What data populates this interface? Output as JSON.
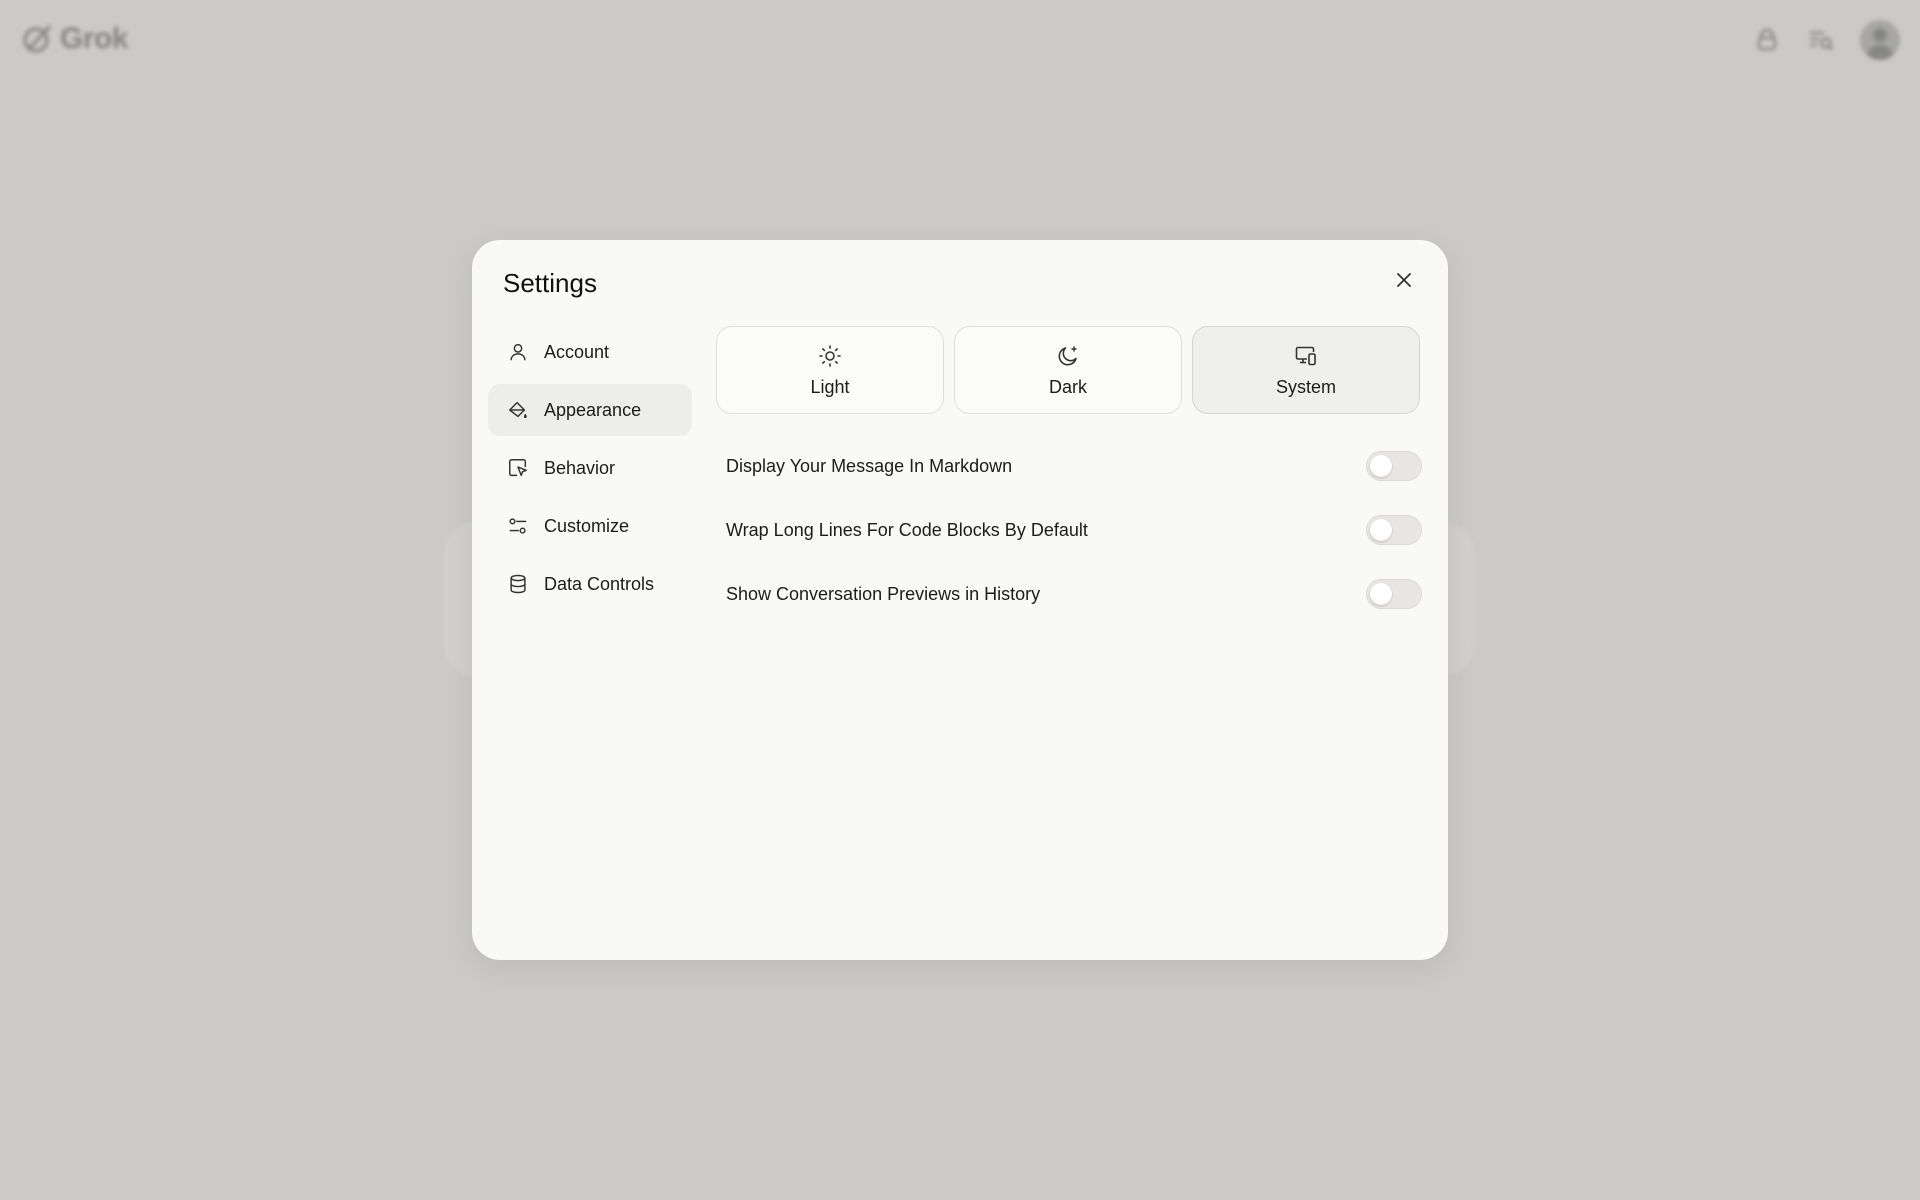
{
  "background": {
    "app_name": "Grok"
  },
  "settings": {
    "title": "Settings",
    "nav": [
      {
        "label": "Account",
        "icon": "user-icon"
      },
      {
        "label": "Appearance",
        "icon": "paint-bucket-icon",
        "active": true
      },
      {
        "label": "Behavior",
        "icon": "cursor-window-icon"
      },
      {
        "label": "Customize",
        "icon": "sliders-icon"
      },
      {
        "label": "Data Controls",
        "icon": "database-icon"
      }
    ],
    "themes": [
      {
        "label": "Light",
        "icon": "sun-icon"
      },
      {
        "label": "Dark",
        "icon": "moon-icon"
      },
      {
        "label": "System",
        "icon": "monitor-phone-icon",
        "selected": true
      }
    ],
    "toggles": [
      {
        "label": "Display Your Message In Markdown",
        "on": false
      },
      {
        "label": "Wrap Long Lines For Code Blocks By Default",
        "on": false
      },
      {
        "label": "Show Conversation Previews in History",
        "on": false
      }
    ]
  },
  "colors": {
    "overlay": "#cbcac8",
    "modal_bg": "#f9f9f7",
    "active_bg": "#ededeb"
  }
}
